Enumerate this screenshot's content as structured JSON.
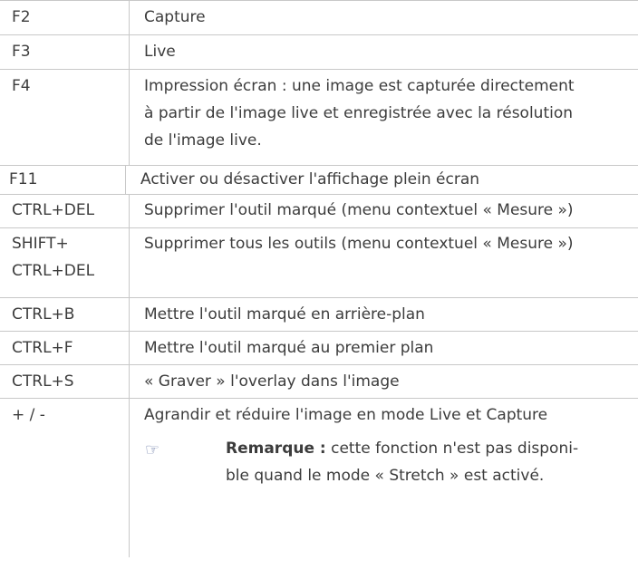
{
  "rows": [
    {
      "key": "F2",
      "desc": "Capture"
    },
    {
      "key": "F3",
      "desc": "Live"
    },
    {
      "key": "F4",
      "desc_lines": [
        "Impression écran : une image est capturée directement",
        "à partir de l'image live et enregistrée avec la résolution",
        "de l'image live."
      ]
    },
    {
      "key": "F11",
      "desc": "Activer ou désactiver l'affichage plein écran"
    },
    {
      "key": "CTRL+DEL",
      "desc": "Supprimer l'outil marqué (menu contextuel « Mesure »)"
    },
    {
      "key_lines": [
        "SHIFT+",
        "CTRL+DEL"
      ],
      "desc": "Supprimer tous les outils (menu contextuel « Mesure »)"
    },
    {
      "key": "CTRL+B",
      "desc": "Mettre l'outil marqué en arrière-plan"
    },
    {
      "key": "CTRL+F",
      "desc": "Mettre l'outil marqué au premier plan"
    },
    {
      "key": "CTRL+S",
      "desc": "« Graver » l'overlay dans l'image"
    },
    {
      "key": "+ / -",
      "desc": "Agrandir et réduire l'image en mode Live et Capture"
    }
  ],
  "note": {
    "icon": "pointing-hand-icon",
    "label": "Remarque :",
    "text_line1": " cette fonction n'est pas disponi-",
    "text_line2": "ble quand le mode « Stretch » est activé."
  }
}
